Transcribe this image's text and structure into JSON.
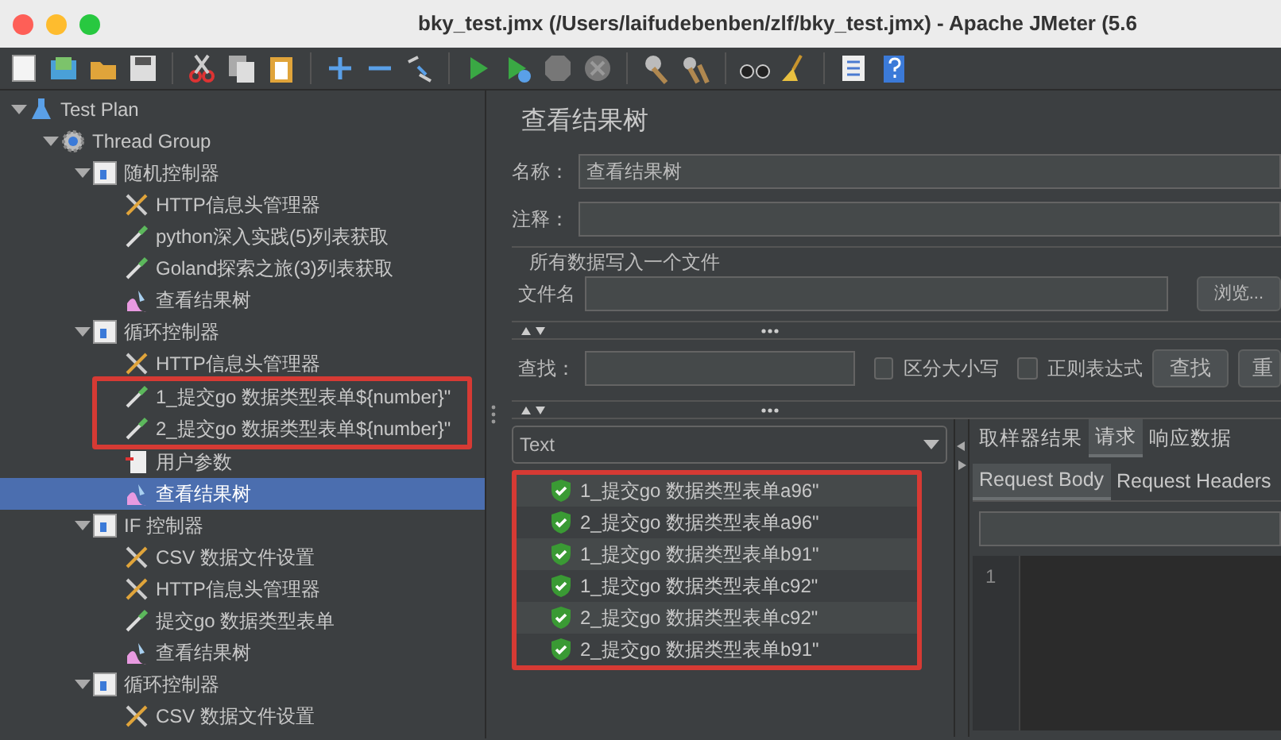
{
  "window": {
    "title": "bky_test.jmx (/Users/laifudebenben/zlf/bky_test.jmx) - Apache JMeter (5.6"
  },
  "tree": [
    {
      "label": "Test Plan",
      "kind": "plan",
      "expanded": true,
      "selected": false,
      "highlighted": false,
      "children": [
        {
          "label": "Thread Group",
          "kind": "threads",
          "expanded": true,
          "selected": false,
          "highlighted": false,
          "children": [
            {
              "label": "随机控制器",
              "kind": "controller",
              "expanded": true,
              "selected": false,
              "highlighted": false,
              "children": [
                {
                  "label": "HTTP信息头管理器",
                  "kind": "config",
                  "selected": false,
                  "highlighted": false
                },
                {
                  "label": "python深入实践(5)列表获取",
                  "kind": "sampler",
                  "selected": false,
                  "highlighted": false
                },
                {
                  "label": "Goland探索之旅(3)列表获取",
                  "kind": "sampler",
                  "selected": false,
                  "highlighted": false
                },
                {
                  "label": "查看结果树",
                  "kind": "listener",
                  "selected": false,
                  "highlighted": false
                }
              ]
            },
            {
              "label": "循环控制器",
              "kind": "controller",
              "expanded": true,
              "selected": false,
              "highlighted": false,
              "children": [
                {
                  "label": "HTTP信息头管理器",
                  "kind": "config",
                  "selected": false,
                  "highlighted": false
                },
                {
                  "label": "1_提交go 数据类型表单${number}\"",
                  "kind": "sampler",
                  "selected": false,
                  "highlighted": true
                },
                {
                  "label": "2_提交go 数据类型表单${number}\"",
                  "kind": "sampler",
                  "selected": false,
                  "highlighted": true
                },
                {
                  "label": "用户参数",
                  "kind": "preprocessor",
                  "selected": false,
                  "highlighted": false
                },
                {
                  "label": "查看结果树",
                  "kind": "listener",
                  "selected": true,
                  "highlighted": false
                }
              ]
            },
            {
              "label": "IF 控制器",
              "kind": "controller",
              "expanded": true,
              "selected": false,
              "highlighted": false,
              "children": [
                {
                  "label": "CSV 数据文件设置",
                  "kind": "config",
                  "selected": false,
                  "highlighted": false
                },
                {
                  "label": "HTTP信息头管理器",
                  "kind": "config",
                  "selected": false,
                  "highlighted": false
                },
                {
                  "label": "提交go 数据类型表单",
                  "kind": "sampler",
                  "selected": false,
                  "highlighted": false
                },
                {
                  "label": "查看结果树",
                  "kind": "listener",
                  "selected": false,
                  "highlighted": false
                }
              ]
            },
            {
              "label": "循环控制器",
              "kind": "controller",
              "expanded": true,
              "selected": false,
              "highlighted": false,
              "children": [
                {
                  "label": "CSV 数据文件设置",
                  "kind": "config",
                  "selected": false,
                  "highlighted": false
                }
              ]
            }
          ]
        }
      ]
    }
  ],
  "panel": {
    "title": "查看结果树",
    "name_label": "名称：",
    "name_value": "查看结果树",
    "comment_label": "注释：",
    "file_group": "所有数据写入一个文件",
    "file_label": "文件名",
    "browse_button": "浏览...",
    "search_label": "查找：",
    "options": [
      {
        "label": "区分大小写",
        "checked": false
      },
      {
        "label": "正则表达式",
        "checked": false
      }
    ],
    "search_button": "查找",
    "reset_button": "重",
    "renderer": "Text",
    "results": [
      {
        "label": "1_提交go 数据类型表单a96\""
      },
      {
        "label": "2_提交go 数据类型表单a96\""
      },
      {
        "label": "1_提交go 数据类型表单b91\""
      },
      {
        "label": "1_提交go 数据类型表单c92\""
      },
      {
        "label": "2_提交go 数据类型表单c92\""
      },
      {
        "label": "2_提交go 数据类型表单b91\""
      }
    ],
    "tabs": [
      {
        "label": "取样器结果",
        "selected": false
      },
      {
        "label": "请求",
        "selected": true
      },
      {
        "label": "响应数据",
        "selected": false
      }
    ],
    "subtabs": [
      {
        "label": "Request Body",
        "selected": true
      },
      {
        "label": "Request Headers",
        "selected": false
      }
    ],
    "line_number": "1"
  }
}
